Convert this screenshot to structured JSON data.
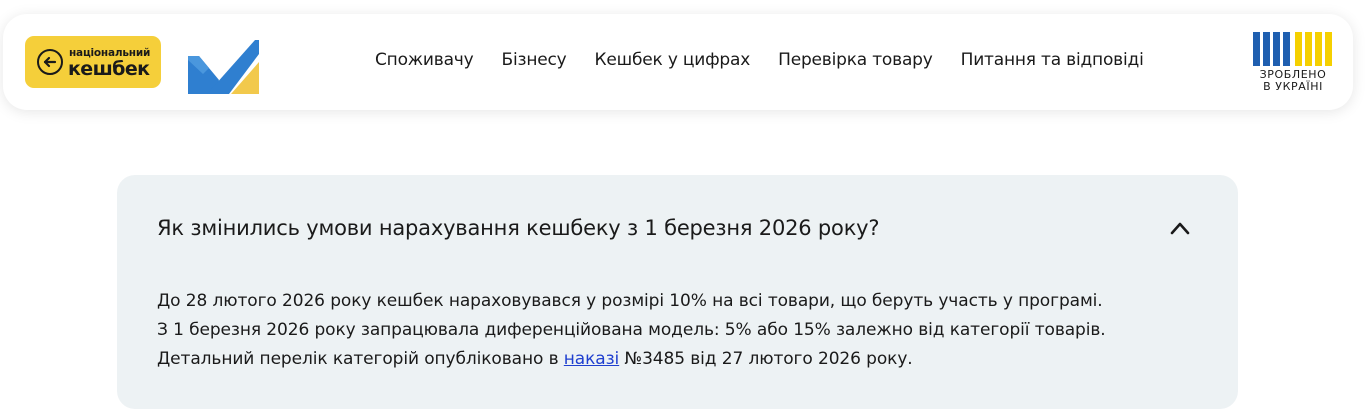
{
  "header": {
    "logo_line1": "національний",
    "logo_line2": "кешбек",
    "nav": [
      {
        "label": "Споживачу"
      },
      {
        "label": "Бізнесу"
      },
      {
        "label": "Кешбек у цифрах"
      },
      {
        "label": "Перевірка товару"
      },
      {
        "label": "Питання та відповіді"
      }
    ],
    "made_line1": "ЗРОБЛЕНО",
    "made_line2": "В УКРАЇНІ"
  },
  "faq": {
    "question": "Як змінились умови нарахування кешбеку з 1 березня 2026 року?",
    "expanded": true,
    "answer_line1": "До 28 лютого 2026 року кешбек нараховувався у розмірі 10% на всі товари, що беруть участь у програмі.",
    "answer_line2": "З 1 березня 2026 року запрацювала диференційована модель: 5% або 15% залежно від категорії товарів.",
    "answer_line3_before": "Детальний перелік категорій опубліковано в ",
    "answer_link": "наказі",
    "answer_line3_after": " №3485 від 27 лютого 2026 року."
  },
  "colors": {
    "brand_yellow": "#f5cf3a",
    "ukraine_blue": "#1f5fb0",
    "ukraine_yellow": "#f5d000",
    "accordion_bg": "#edf2f4",
    "link": "#1f3fcf"
  },
  "icons": {
    "cashback_coin": "arrow-left-coin-icon",
    "ministry_logo": "ministry-logo-icon",
    "chevron": "chevron-up-icon"
  }
}
